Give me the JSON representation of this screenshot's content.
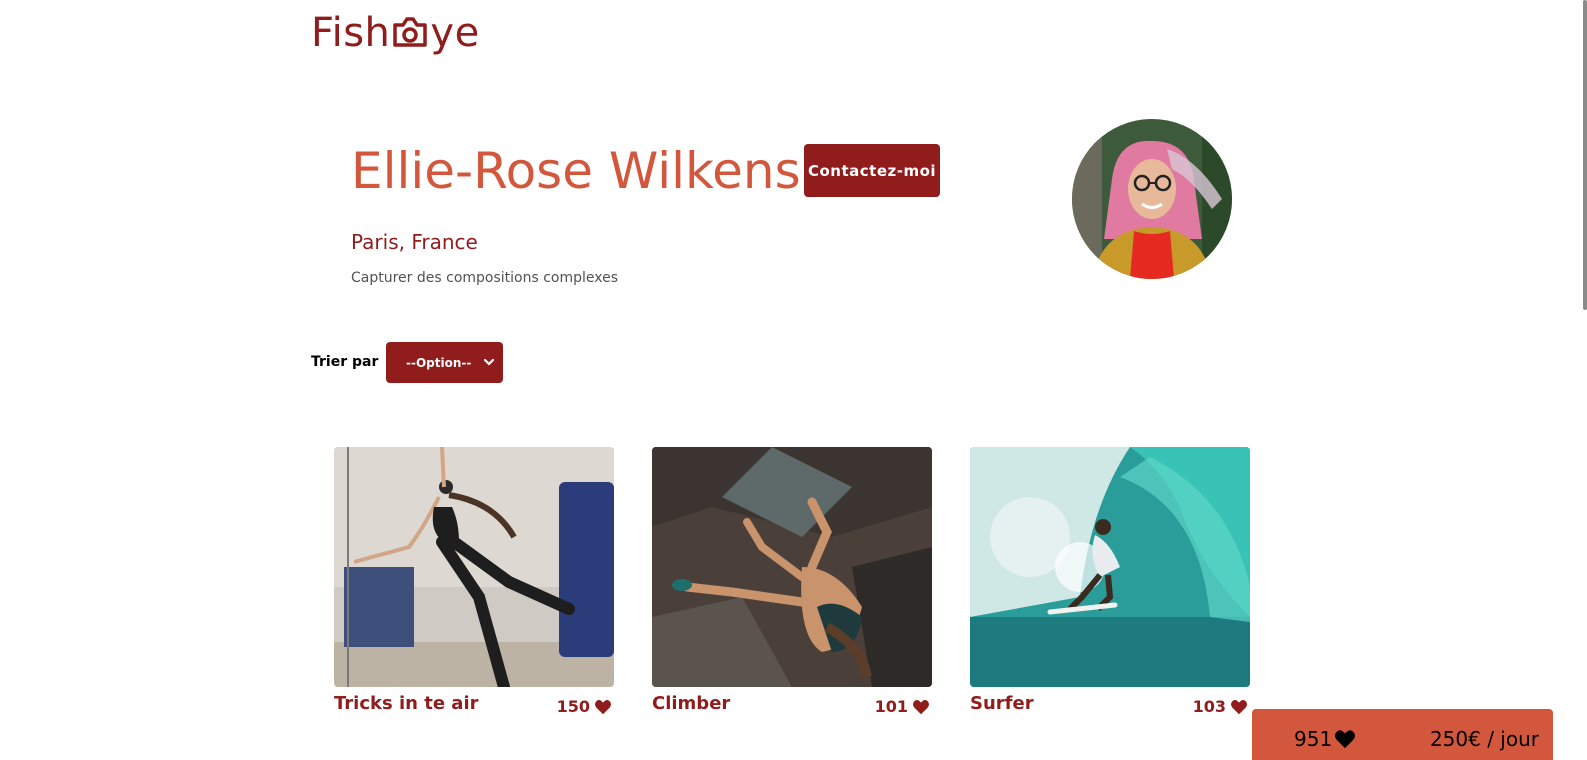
{
  "logo": {
    "text_left": "Fish",
    "text_right": "ye",
    "icon": "camera-icon"
  },
  "photographer": {
    "name": "Ellie-Rose Wilkens",
    "location": "Paris, France",
    "tagline": "Capturer des compositions complexes",
    "contact_label": "Contactez-moi"
  },
  "sort": {
    "label": "Trier par",
    "selected": "--Option--"
  },
  "media": [
    {
      "title": "Tricks in te air",
      "likes": "150"
    },
    {
      "title": "Climber",
      "likes": "101"
    },
    {
      "title": "Surfer",
      "likes": "103"
    }
  ],
  "summary": {
    "total_likes": "951",
    "price": "250€ / jour"
  },
  "colors": {
    "primary": "#901c1c",
    "accent": "#d3573c"
  }
}
